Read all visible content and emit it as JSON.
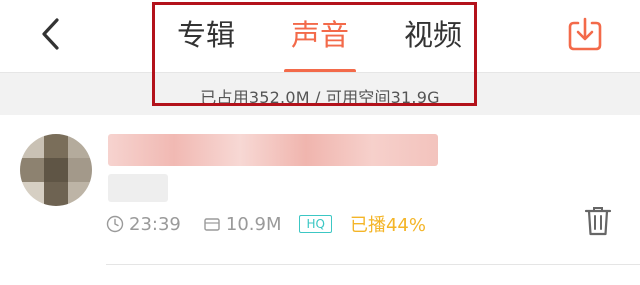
{
  "header": {
    "back_icon": "chevron-left-icon",
    "tabs": [
      {
        "label": "专辑",
        "active": false
      },
      {
        "label": "声音",
        "active": true
      },
      {
        "label": "视频",
        "active": false
      }
    ],
    "download_icon": "download-icon"
  },
  "storage": {
    "text": "已占用352.0M / 可用空间31.9G"
  },
  "track": {
    "duration": "23:39",
    "size": "10.9M",
    "quality_badge": "HQ",
    "played": "已播44%",
    "played_fraction": 0.44,
    "delete_icon": "trash-icon"
  },
  "colors": {
    "accent": "#f36a4a",
    "hq_badge": "#3cc7c4",
    "played": "#f4b528",
    "annotation_box": "#b3121b"
  }
}
